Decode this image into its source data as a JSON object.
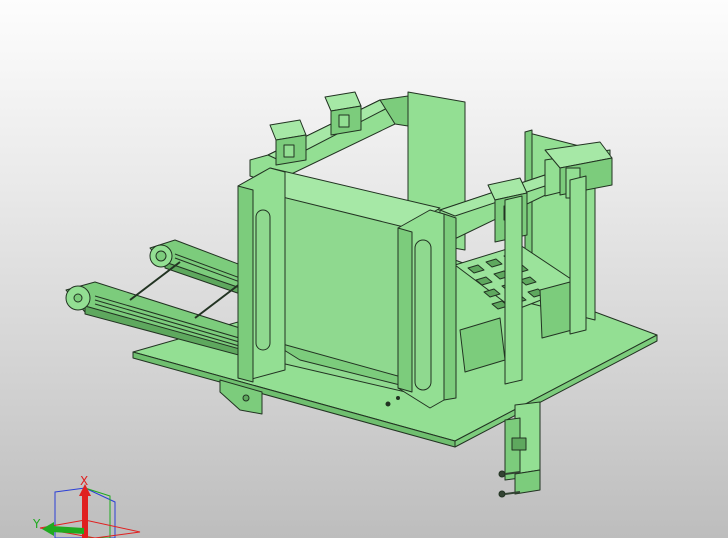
{
  "viewport": {
    "background_top": "#fdfdfd",
    "background_bottom": "#bdbdbd"
  },
  "model": {
    "fill": "#93df93",
    "fill_light": "#a6e8a6",
    "fill_dark": "#7ccc7c",
    "fill_shadow": "#5ea85e",
    "edge": "#223322"
  },
  "triad": {
    "x_label": "X",
    "y_label": "Y",
    "x_color": "#e02020",
    "y_color": "#1faa1f",
    "z_color": "#2b3fd6"
  }
}
